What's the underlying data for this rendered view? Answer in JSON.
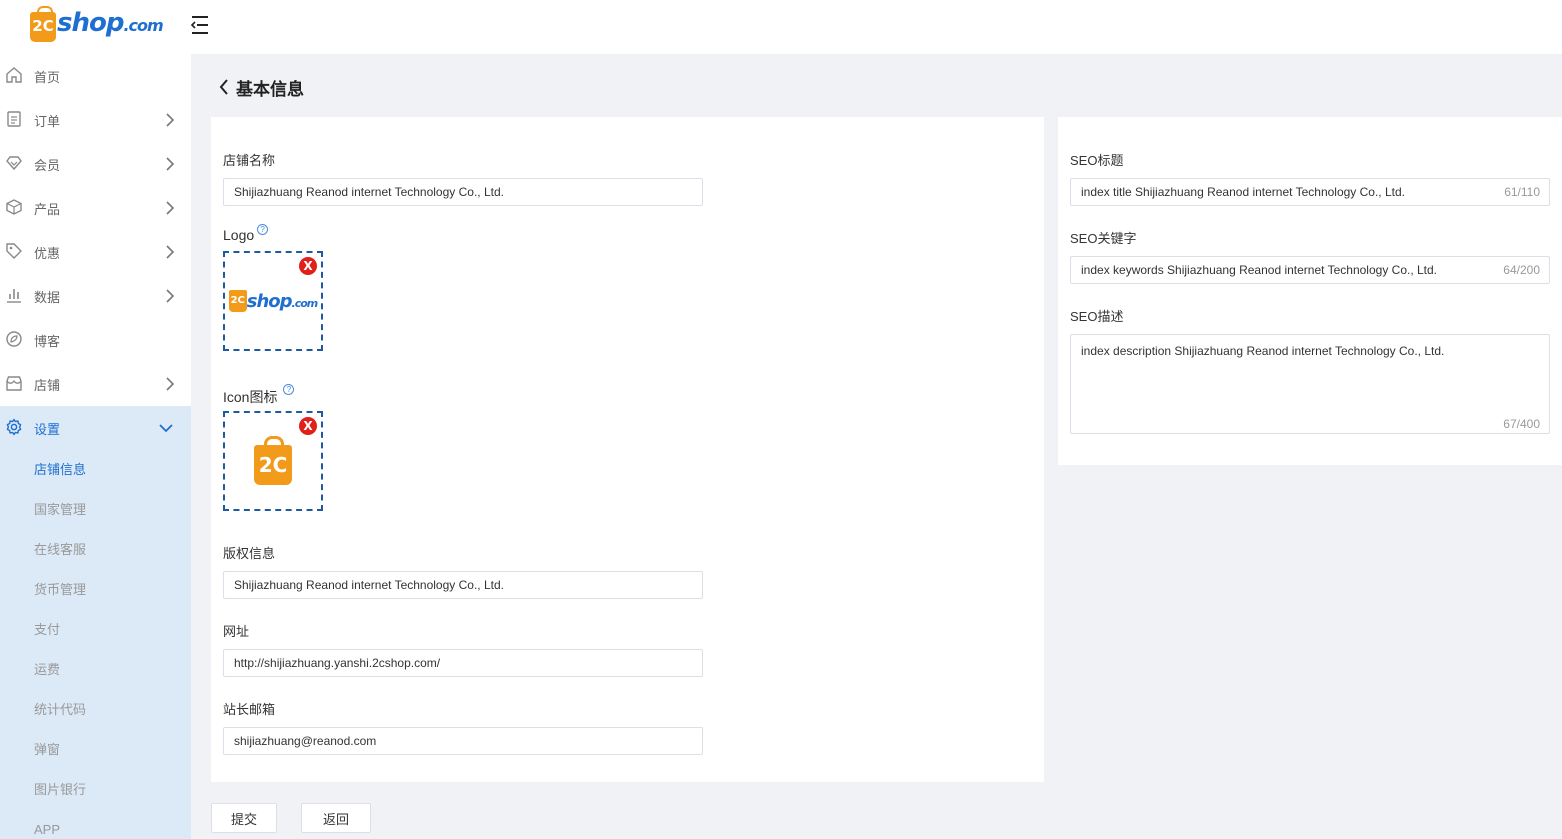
{
  "brand": {
    "mark": "2C",
    "name": "shop",
    "domain": ".com",
    "primary_color": "#1f6fd0",
    "accent_color": "#f29b1b"
  },
  "sidebar": {
    "items": [
      {
        "label": "首页",
        "icon": "home-icon"
      },
      {
        "label": "订单",
        "icon": "order-icon"
      },
      {
        "label": "会员",
        "icon": "member-icon"
      },
      {
        "label": "产品",
        "icon": "product-icon"
      },
      {
        "label": "优惠",
        "icon": "tag-icon"
      },
      {
        "label": "数据",
        "icon": "chart-icon"
      },
      {
        "label": "博客",
        "icon": "blog-icon"
      },
      {
        "label": "店铺",
        "icon": "store-icon"
      },
      {
        "label": "设置",
        "icon": "gear-icon"
      }
    ],
    "sub_items": [
      "店铺信息",
      "国家管理",
      "在线客服",
      "货币管理",
      "支付",
      "运费",
      "统计代码",
      "弹窗",
      "图片银行",
      "APP"
    ]
  },
  "page": {
    "title": "基本信息"
  },
  "form": {
    "store_name": {
      "label": "店铺名称",
      "value": "Shijiazhuang Reanod internet Technology Co., Ltd."
    },
    "logo": {
      "label": "Logo",
      "help": "?",
      "delete": "X"
    },
    "icon": {
      "label": "Icon图标",
      "help": "?",
      "delete": "X"
    },
    "copyright": {
      "label": "版权信息",
      "value": "Shijiazhuang Reanod internet Technology Co., Ltd."
    },
    "website": {
      "label": "网址",
      "value": "http://shijiazhuang.yanshi.2cshop.com/"
    },
    "email": {
      "label": "站长邮箱",
      "value": "shijiazhuang@reanod.com"
    }
  },
  "seo": {
    "title": {
      "label": "SEO标题",
      "value": "index title Shijiazhuang Reanod internet Technology Co., Ltd.",
      "counter": "61/110"
    },
    "keywords": {
      "label": "SEO关键字",
      "value": "index keywords Shijiazhuang Reanod internet Technology Co., Ltd.",
      "counter": "64/200"
    },
    "description": {
      "label": "SEO描述",
      "value": "index description Shijiazhuang Reanod internet Technology Co., Ltd.",
      "counter": "67/400"
    }
  },
  "actions": {
    "submit": "提交",
    "back": "返回"
  }
}
